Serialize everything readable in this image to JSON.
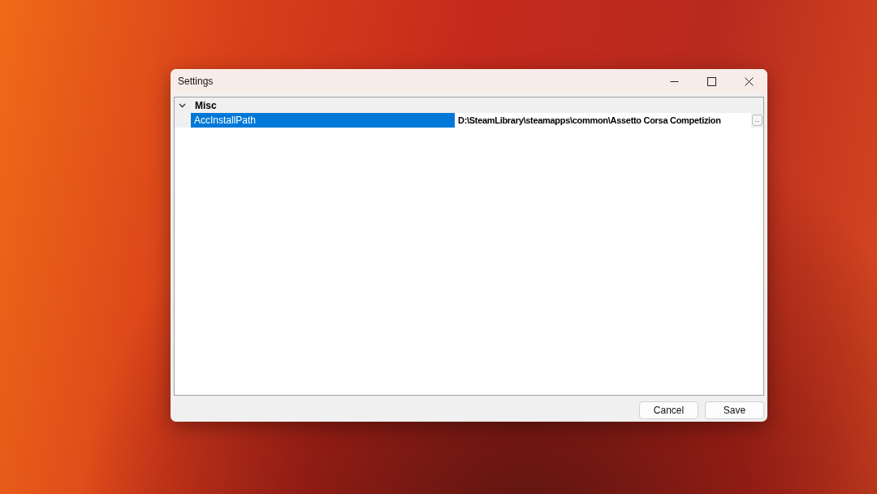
{
  "window": {
    "title": "Settings"
  },
  "categories": [
    {
      "name": "Misc",
      "expanded": true,
      "properties": [
        {
          "name": "AccInstallPath",
          "value": "D:\\SteamLibrary\\steamapps\\common\\Assetto Corsa Competizion",
          "selected": true,
          "button": "..."
        }
      ]
    }
  ],
  "buttons": [
    "Cancel",
    "Save"
  ]
}
